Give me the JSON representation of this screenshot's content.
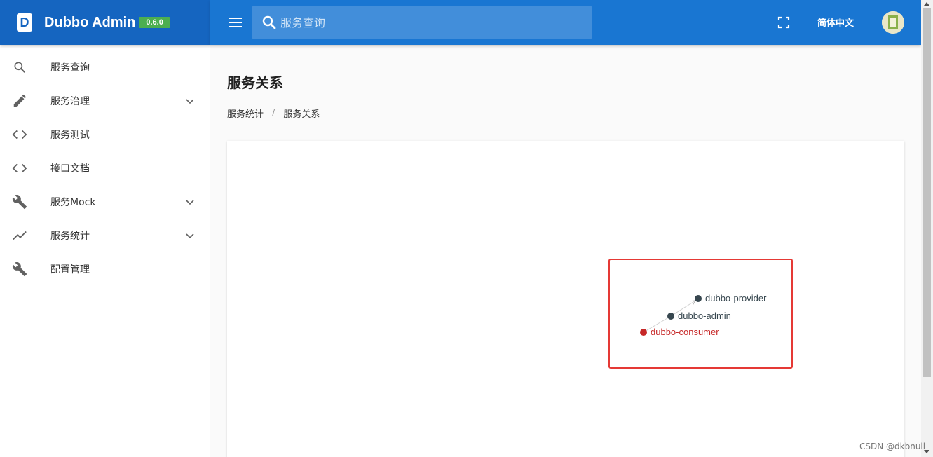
{
  "brand": {
    "logo": "D",
    "title": "Dubbo Admin",
    "version": "0.6.0"
  },
  "sidebar": {
    "items": [
      {
        "label": "服务查询",
        "icon": "search-icon",
        "expandable": false
      },
      {
        "label": "服务治理",
        "icon": "pencil-icon",
        "expandable": true
      },
      {
        "label": "服务测试",
        "icon": "code-icon",
        "expandable": false
      },
      {
        "label": "接口文档",
        "icon": "code-icon",
        "expandable": false
      },
      {
        "label": "服务Mock",
        "icon": "wrench-icon",
        "expandable": true
      },
      {
        "label": "服务统计",
        "icon": "trending-icon",
        "expandable": true
      },
      {
        "label": "配置管理",
        "icon": "wrench-icon",
        "expandable": false
      }
    ]
  },
  "header": {
    "search_placeholder": "服务查询",
    "language": "简体中文"
  },
  "page": {
    "title": "服务关系",
    "breadcrumb": [
      "服务统计",
      "服务关系"
    ]
  },
  "graph": {
    "nodes": [
      {
        "label": "dubbo-provider",
        "color": "#37474f"
      },
      {
        "label": "dubbo-admin",
        "color": "#37474f"
      },
      {
        "label": "dubbo-consumer",
        "color": "#c62828"
      }
    ]
  },
  "colors": {
    "brand_bg": "#1565c0",
    "appbar_bg": "#1976d2",
    "version_badge": "#4caf50",
    "highlight": "#e53935"
  },
  "watermark": "CSDN @dkbnull"
}
